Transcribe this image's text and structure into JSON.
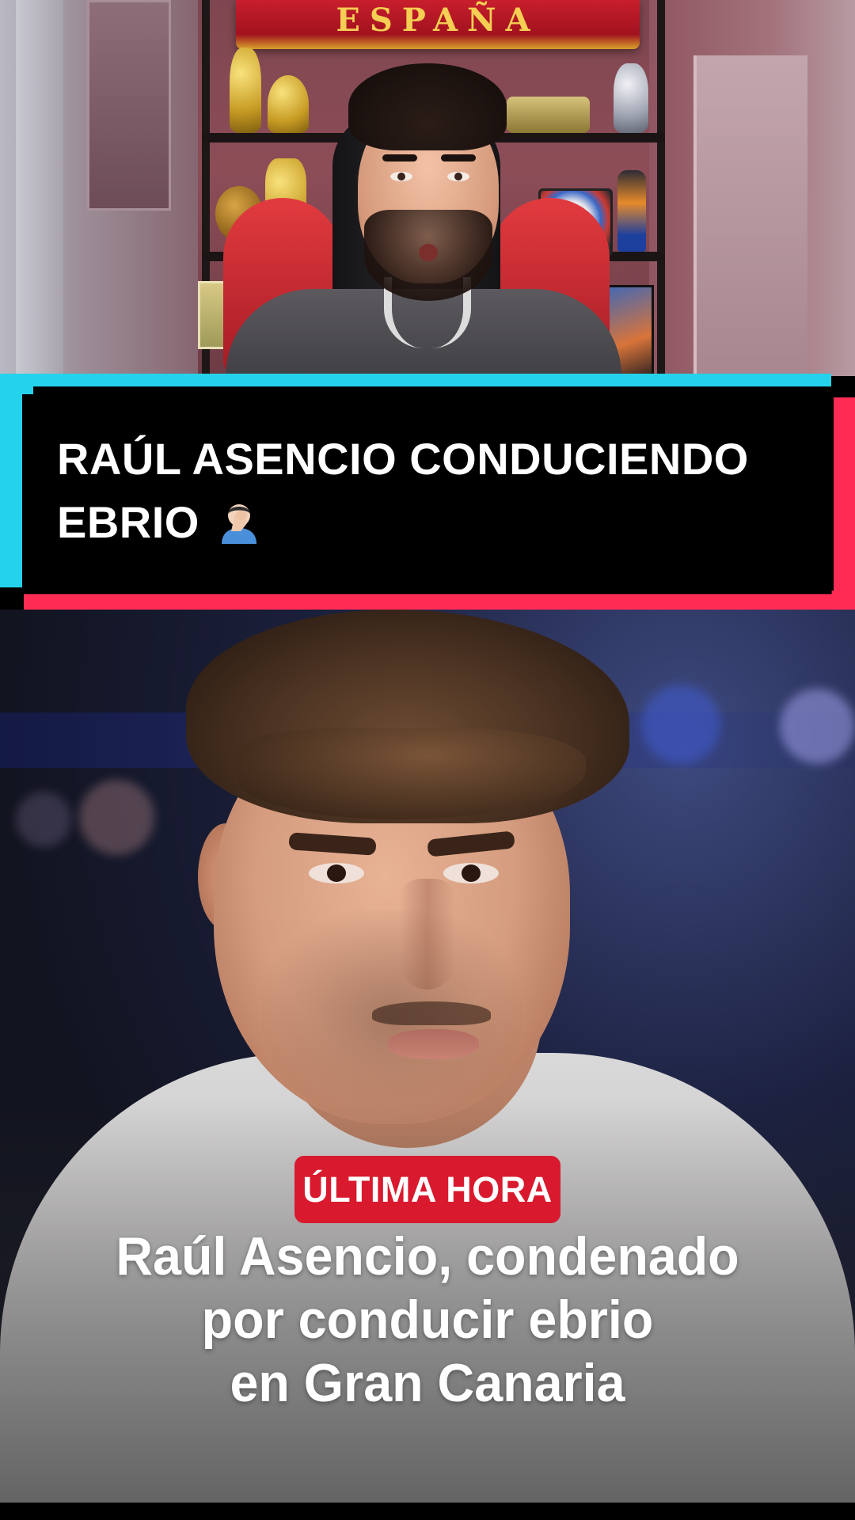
{
  "room": {
    "scarf_text": "ESPAÑA"
  },
  "banner": {
    "title": "RAÚL ASENCIO CONDUCIENDO EBRIO",
    "emoji": "facepalm-icon",
    "colors": {
      "cyan": "#25d2ec",
      "red": "#fe2c55",
      "panel": "#000000",
      "text": "#ffffff"
    }
  },
  "news": {
    "badge": "ÚLTIMA HORA",
    "badge_color": "#d9192d",
    "headline_lines": [
      "Raúl Asencio, condenado",
      "por conducir ebrio",
      "en Gran Canaria"
    ]
  }
}
